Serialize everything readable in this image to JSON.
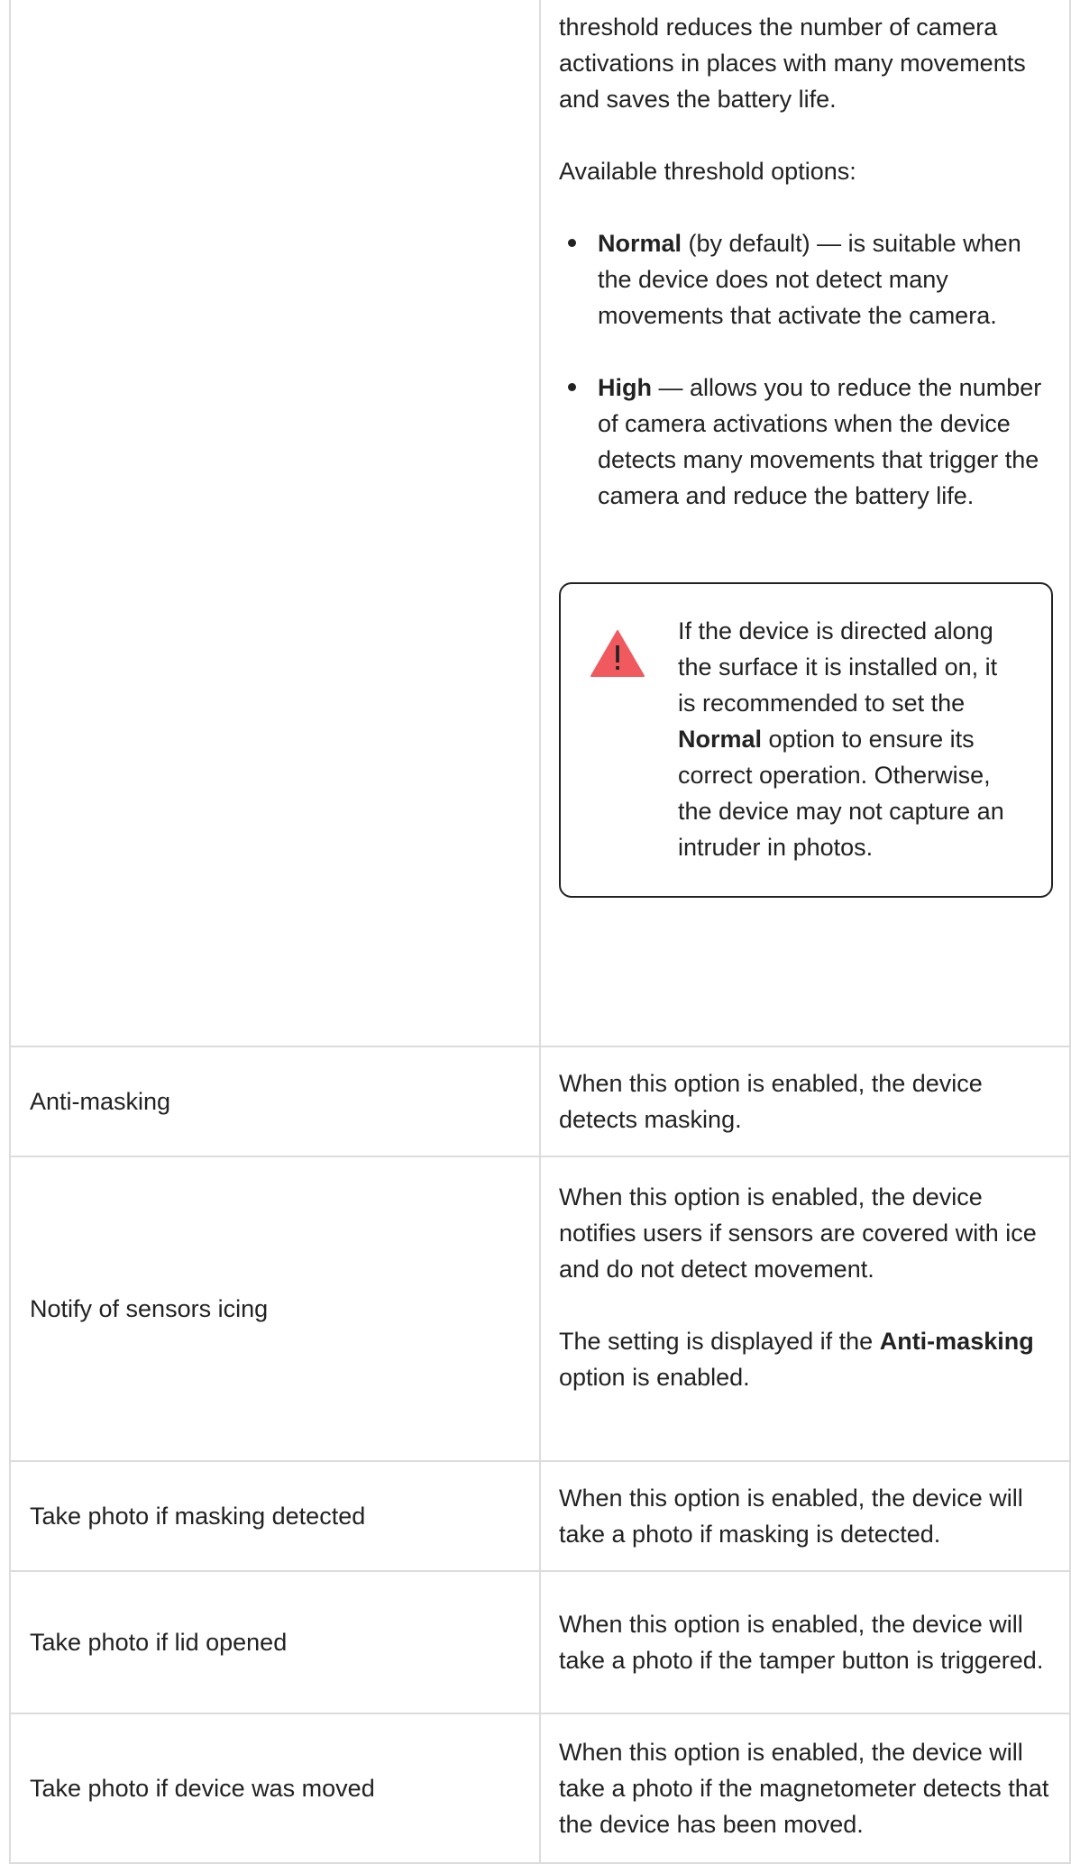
{
  "rows": [
    {
      "name": "",
      "desc_intro": "threshold reduces the number of camera activations in places with many movements and saves the battery life.",
      "desc_options_label": "Available threshold options:",
      "options": [
        {
          "term": "Normal",
          "text": " (by default) — is suitable when the device does not detect many movements that activate the camera."
        },
        {
          "term": "High",
          "text": " — allows you to reduce the number of camera activations when the device detects many movements that trigger the camera and reduce the battery life."
        }
      ],
      "warning": {
        "icon": "warning-triangle-icon",
        "icon_color": "#f0595e",
        "text_before": "If the device is directed along the surface it is installed on, it is recommended to set the ",
        "bold": "Normal",
        "text_after": " option to ensure its correct operation. Otherwise, the device may not capture an intruder in photos."
      }
    },
    {
      "name": "Anti-masking",
      "desc": "When this option is enabled, the device detects masking."
    },
    {
      "name": "Notify of sensors icing",
      "desc": "When this option is enabled, the device notifies users if sensors are covered with ice and do not detect movement.",
      "note_before": "The setting is displayed if the ",
      "note_bold": "Anti-masking",
      "note_after": " option is enabled."
    },
    {
      "name": "Take photo if masking detected",
      "desc": "When this option is enabled, the device will take a photo if masking is detected."
    },
    {
      "name": "Take photo if lid opened",
      "desc": "When this option is enabled, the device will take a photo if the tamper button is triggered."
    },
    {
      "name": "Take photo if device was moved",
      "desc": "When this option is enabled, the device will take a photo if the magnetometer detects that the device has been moved."
    }
  ]
}
